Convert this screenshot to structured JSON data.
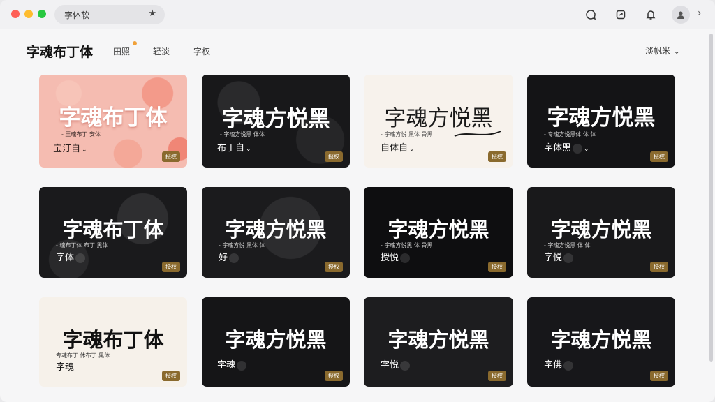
{
  "titlebar": {
    "tab_label": "字体软",
    "star": "★"
  },
  "header": {
    "title": "字魂布丁体",
    "tabs": [
      {
        "label": "田照"
      },
      {
        "label": "轻淡"
      },
      {
        "label": "字权"
      }
    ],
    "sort_label": "淡帆米",
    "sort_chev": "⌄"
  },
  "cards": [
    {
      "title": "字魂布丁体",
      "subtitle": "- 王魂布丁 安体",
      "face": "宝汀自",
      "chev": "⌄",
      "badge": "授权",
      "theme": "pink"
    },
    {
      "title": "字魂方悦黑",
      "subtitle": "- 字魂方悦黑 体体",
      "face": "布丁自",
      "chev": "⌄",
      "badge": "授权",
      "theme": "dark"
    },
    {
      "title": "字魂方悦黑",
      "subtitle": "- 字魂方悦 黑体 骨黑",
      "face": "自体自",
      "chev": "⌄",
      "badge": "授权",
      "theme": "cream"
    },
    {
      "title": "字魂方悦黑",
      "subtitle": "- 专魂方悦黑体 体 体",
      "face": "字体黑",
      "chev": "⌄",
      "badge": "授权",
      "theme": "dark"
    },
    {
      "title": "字魂布丁体",
      "subtitle": "- 魂布丁体 布丁 黑体",
      "face": "字体",
      "chev": "",
      "badge": "授权",
      "theme": "dark"
    },
    {
      "title": "字魂方悦黑",
      "subtitle": "- 字魂方悦 黑体 体",
      "face": "好",
      "chev": "",
      "badge": "授权",
      "theme": "dark"
    },
    {
      "title": "字魂方悦黑",
      "subtitle": "- 字魂方悦黑 体 骨黑",
      "face": "授悦",
      "chev": "",
      "badge": "授权",
      "theme": "black"
    },
    {
      "title": "字魂方悦黑",
      "subtitle": "- 字魂方悦黑 体 体",
      "face": "字悦",
      "chev": "",
      "badge": "授权",
      "theme": "dark"
    },
    {
      "title": "字魂布丁体",
      "subtitle": "专魂布丁 体布丁 黑体",
      "face": "字魂",
      "chev": "",
      "badge": "授权",
      "theme": "cream"
    },
    {
      "title": "字魂方悦黑",
      "subtitle": "",
      "face": "字魂",
      "chev": "",
      "badge": "授权",
      "theme": "dark"
    },
    {
      "title": "字魂方悦黑",
      "subtitle": "",
      "face": "字悦",
      "chev": "",
      "badge": "授权",
      "theme": "dark"
    },
    {
      "title": "字魂方悦黑",
      "subtitle": "",
      "face": "字佛",
      "chev": "",
      "badge": "授权",
      "theme": "dark"
    }
  ],
  "colors": {
    "accent_dot": "#f0a13a",
    "badge": "#8a6a2e",
    "pink_bg": "#f2b5ab",
    "dark_bg": "#1b1b1d",
    "cream_bg": "#f6f1ea"
  },
  "icons": [
    "star-icon",
    "chat-icon",
    "share-icon",
    "bell-icon",
    "user-icon",
    "chevron-right-icon"
  ]
}
